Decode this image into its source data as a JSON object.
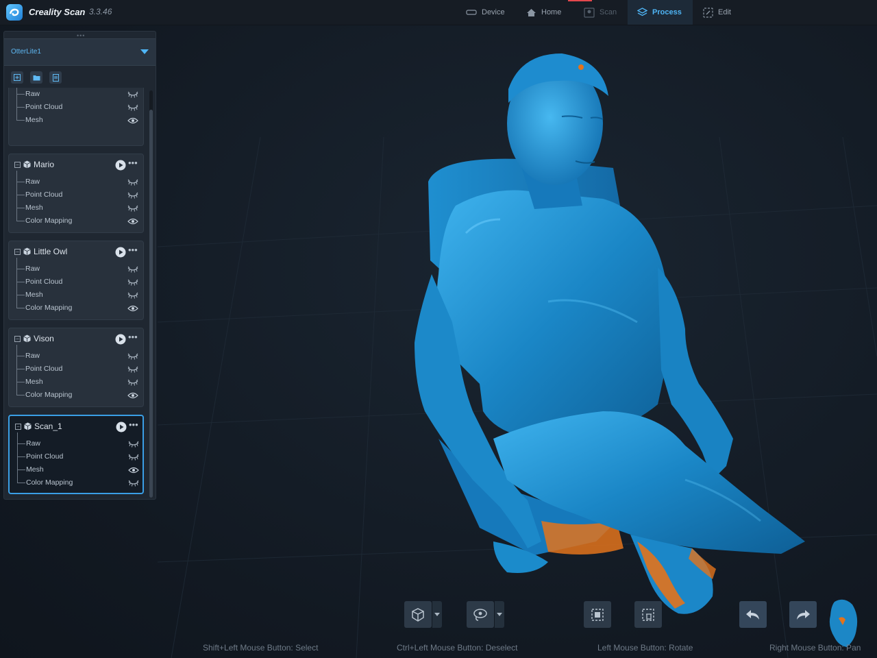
{
  "app": {
    "title": "Creality Scan",
    "version": "3.3.46"
  },
  "nav": {
    "device": "Device",
    "home": "Home",
    "scan": "Scan",
    "process": "Process",
    "edit": "Edit"
  },
  "panel": {
    "device_name": "OtterLite1",
    "projects": [
      {
        "name": "",
        "layers": [
          {
            "label": "Raw",
            "visible": false
          },
          {
            "label": "Point Cloud",
            "visible": false
          },
          {
            "label": "Mesh",
            "visible": true
          }
        ]
      },
      {
        "name": "Mario",
        "layers": [
          {
            "label": "Raw",
            "visible": false
          },
          {
            "label": "Point Cloud",
            "visible": false
          },
          {
            "label": "Mesh",
            "visible": false
          },
          {
            "label": "Color Mapping",
            "visible": true
          }
        ]
      },
      {
        "name": "Little Owl",
        "layers": [
          {
            "label": "Raw",
            "visible": false
          },
          {
            "label": "Point Cloud",
            "visible": false
          },
          {
            "label": "Mesh",
            "visible": false
          },
          {
            "label": "Color Mapping",
            "visible": true
          }
        ]
      },
      {
        "name": "Vison",
        "layers": [
          {
            "label": "Raw",
            "visible": false
          },
          {
            "label": "Point Cloud",
            "visible": false
          },
          {
            "label": "Mesh",
            "visible": false
          },
          {
            "label": "Color Mapping",
            "visible": true
          }
        ]
      },
      {
        "name": "Scan_1",
        "selected": true,
        "layers": [
          {
            "label": "Raw",
            "visible": false
          },
          {
            "label": "Point Cloud",
            "visible": false
          },
          {
            "label": "Mesh",
            "visible": true
          },
          {
            "label": "Color Mapping",
            "visible": false
          }
        ]
      }
    ]
  },
  "hints": {
    "select": "Shift+Left Mouse Button:  Select",
    "deselect": "Ctrl+Left Mouse Button:  Deselect",
    "rotate": "Left Mouse Button:  Rotate",
    "pan": "Right Mouse Button:  Pan"
  },
  "icons": {
    "visible": "eye-icon",
    "hidden": "eye-closed-icon",
    "project": "cube-icon"
  },
  "colors": {
    "accent": "#4fb5f5",
    "mesh": "#1c87c6",
    "mesh_highlight": "#3fb0ea",
    "mesh_defect": "#e2731c",
    "background": "#141b24",
    "panel": "#1f2731"
  }
}
